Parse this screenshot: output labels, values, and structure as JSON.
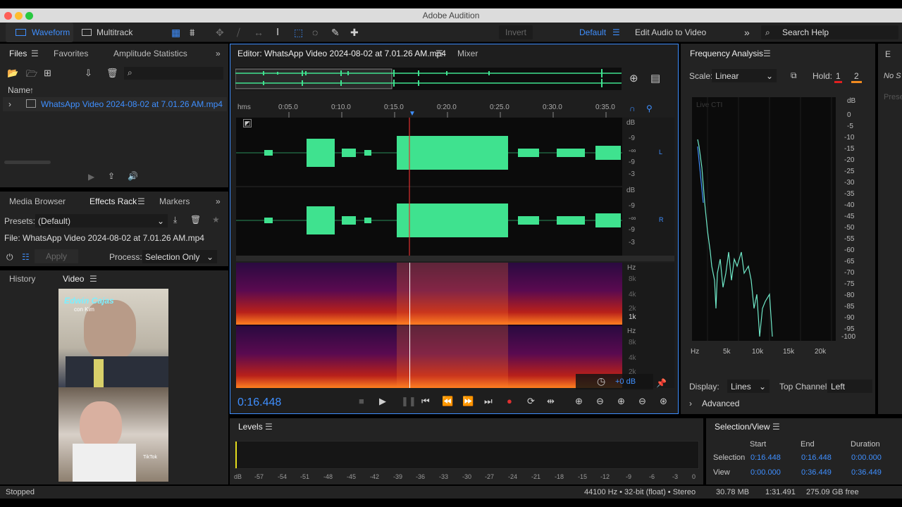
{
  "app": {
    "title": "Adobe Audition"
  },
  "toolbar": {
    "waveform": "Waveform",
    "multitrack": "Multitrack",
    "invert": "Invert",
    "workspace_default": "Default",
    "workspace_edit": "Edit Audio to Video",
    "search_help": "Search Help"
  },
  "files_panel": {
    "tabs": [
      "Files",
      "Favorites",
      "Amplitude Statistics"
    ],
    "name_header": "Name",
    "file_name": "WhatsApp Video 2024-08-02 at 7.01.26 AM.mp4"
  },
  "effects_panel": {
    "tabs": [
      "Media Browser",
      "Effects Rack",
      "Markers"
    ],
    "presets_label": "Presets:",
    "presets_value": "(Default)",
    "file_label": "File: WhatsApp Video 2024-08-02 at 7.01.26 AM.mp4",
    "apply_label": "Apply",
    "process_label": "Process:",
    "process_value": "Selection Only"
  },
  "history_panel": {
    "tabs": [
      "History",
      "Video"
    ],
    "overlay_text": "Edwin Cajas",
    "overlay_sub": "con Kim",
    "tiktok": "TikTok"
  },
  "editor": {
    "tab_title": "Editor: WhatsApp Video 2024-08-02 at 7.01.26 AM.mp4",
    "mixer": "Mixer",
    "time_ruler": [
      "hms",
      "0:05.0",
      "0:10.0",
      "0:15.0",
      "0:20.0",
      "0:25.0",
      "0:30.0",
      "0:35.0"
    ],
    "db_scale_left": [
      "dB",
      "-9",
      "-∞",
      "-9",
      "-3"
    ],
    "db_scale_right": [
      "dB",
      "-9",
      "-∞",
      "-9",
      "-3"
    ],
    "channel_left": "L",
    "channel_right": "R",
    "hz_scale": [
      "Hz",
      "8k",
      "4k",
      "2k",
      "1k"
    ],
    "hz_scale2": [
      "Hz",
      "8k",
      "4k",
      "2k"
    ],
    "volume_readout": "+0 dB",
    "current_time": "0:16.448",
    "colors": {
      "waveform": "#3fe28f",
      "playhead": "#e03030",
      "accent": "#3f8fff"
    }
  },
  "frequency_panel": {
    "title": "Frequency Analysis",
    "scale_label": "Scale:",
    "scale_value": "Linear",
    "hold_label": "Hold:",
    "hold_1": "1",
    "hold_2": "2",
    "live_cti": "Live CTI",
    "db_labels": [
      "dB",
      "0",
      "-5",
      "-10",
      "-15",
      "-20",
      "-25",
      "-30",
      "-35",
      "-40",
      "-45",
      "-50",
      "-55",
      "-60",
      "-65",
      "-70",
      "-75",
      "-80",
      "-85",
      "-90",
      "-95",
      "-100"
    ],
    "hz_labels": [
      "Hz",
      "5k",
      "10k",
      "15k",
      "20k"
    ],
    "display_label": "Display:",
    "display_value": "Lines",
    "top_channel_label": "Top Channel:",
    "top_channel_value": "Left",
    "advanced": "Advanced",
    "side_text1": "No S",
    "side_text2": "Prese"
  },
  "levels_panel": {
    "title": "Levels",
    "scale": [
      "dB",
      "-57",
      "-54",
      "-51",
      "-48",
      "-45",
      "-42",
      "-39",
      "-36",
      "-33",
      "-30",
      "-27",
      "-24",
      "-21",
      "-18",
      "-15",
      "-12",
      "-9",
      "-6",
      "-3",
      "0"
    ]
  },
  "selection_view": {
    "title": "Selection/View",
    "headers": [
      "Start",
      "End",
      "Duration"
    ],
    "rows": [
      {
        "label": "Selection",
        "start": "0:16.448",
        "end": "0:16.448",
        "duration": "0:00.000"
      },
      {
        "label": "View",
        "start": "0:00.000",
        "end": "0:36.449",
        "duration": "0:36.449"
      }
    ]
  },
  "status_bar": {
    "state": "Stopped",
    "format": "44100 Hz • 32-bit (float) • Stereo",
    "size": "30.78 MB",
    "duration": "1:31.491",
    "free": "275.09 GB free"
  }
}
